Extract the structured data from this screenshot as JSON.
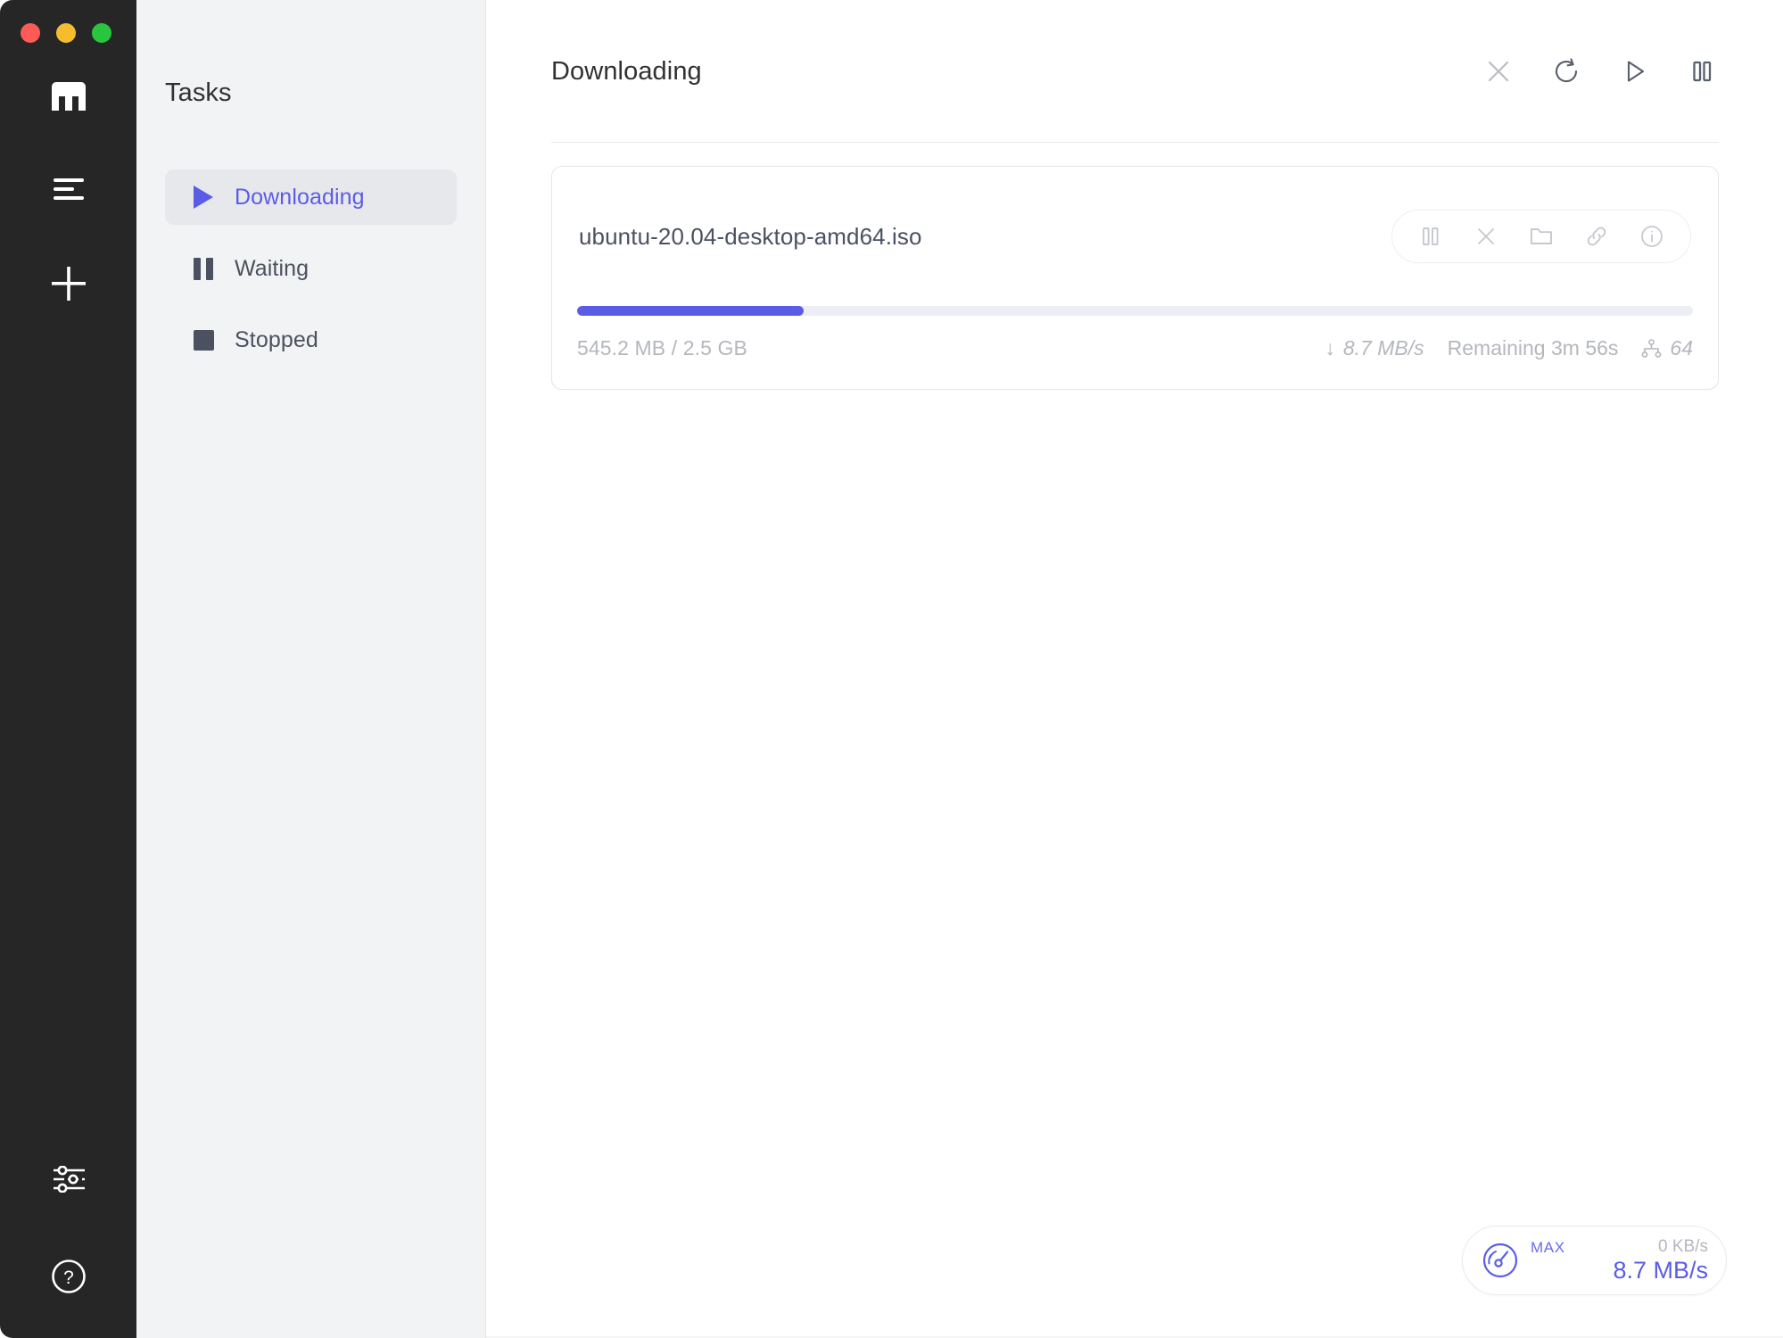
{
  "window": {
    "traffic_lights": [
      {
        "name": "close",
        "color": "#fc5b57"
      },
      {
        "name": "minimize",
        "color": "#f5bc2e"
      },
      {
        "name": "maximize",
        "color": "#29c63d"
      }
    ],
    "logo_label": "m"
  },
  "rail": {
    "items": [
      {
        "icon": "logo-m",
        "label": "Motrix"
      },
      {
        "icon": "task-list-icon",
        "label": "Task list"
      },
      {
        "icon": "plus-icon",
        "label": "New task"
      },
      {
        "icon": "preferences-sliders-icon",
        "label": "Preferences"
      },
      {
        "icon": "help-circle-icon",
        "label": "Help"
      }
    ]
  },
  "sidebar": {
    "title": "Tasks",
    "items": [
      {
        "label": "Downloading",
        "icon": "play-icon",
        "active": true
      },
      {
        "label": "Waiting",
        "icon": "pause-icon",
        "active": false
      },
      {
        "label": "Stopped",
        "icon": "stop-square-icon",
        "active": false
      }
    ]
  },
  "header": {
    "title": "Downloading",
    "actions": [
      {
        "name": "close-icon",
        "label": "Delete selected"
      },
      {
        "name": "refresh-icon",
        "label": "Refresh"
      },
      {
        "name": "play-icon",
        "label": "Resume all"
      },
      {
        "name": "pause-icon",
        "label": "Pause all"
      }
    ]
  },
  "task_card": {
    "filename": "ubuntu-20.04-desktop-amd64.iso",
    "progress_percent": 20.3,
    "size_text": "545.2 MB / 2.5 GB",
    "downloaded": "545.2 MB",
    "total": "2.5 GB",
    "speed": "8.7 MB/s",
    "speed_arrow": "↓",
    "remaining": "Remaining 3m 56s",
    "peers": "64",
    "actions": [
      {
        "name": "pause-icon",
        "label": "Pause"
      },
      {
        "name": "close-icon",
        "label": "Remove"
      },
      {
        "name": "folder-icon",
        "label": "Open folder"
      },
      {
        "name": "link-icon",
        "label": "Copy link"
      },
      {
        "name": "info-icon",
        "label": "Task info"
      }
    ]
  },
  "speed_widget": {
    "max_label": "MAX",
    "upload_speed": "0 KB/s",
    "download_speed": "8.7 MB/s",
    "icon": "speedometer-icon"
  },
  "colors": {
    "accent": "#5b5ce6",
    "rail_bg": "#262626",
    "sidebar_bg": "#f2f3f5",
    "muted_text": "#b4b7bd",
    "body_text": "#4b5160"
  }
}
